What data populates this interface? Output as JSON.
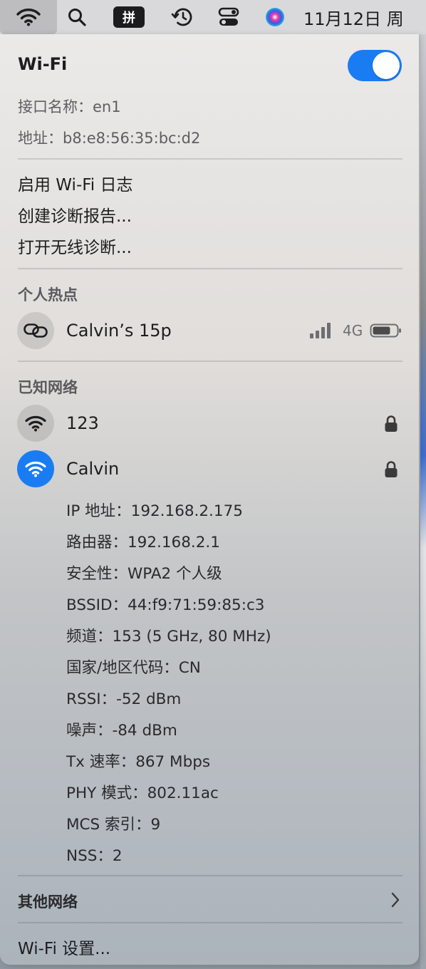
{
  "menubar": {
    "ime_glyph": "拼",
    "date": "11月12日 周"
  },
  "wifi": {
    "title": "Wi-Fi",
    "toggle_on": true,
    "interface_name": "接口名称：en1",
    "address": "地址：b8:e8:56:35:bc:d2"
  },
  "actions": {
    "enable_log": "启用 Wi-Fi 日志",
    "create_report": "创建诊断报告...",
    "open_diagnostics": "打开无线诊断..."
  },
  "hotspot": {
    "section_label": "个人热点",
    "name": "Calvin’s 15p",
    "network_type": "4G",
    "signal_bars": 4
  },
  "known": {
    "section_label": "已知网络",
    "networks": [
      {
        "name": "123",
        "secured": true,
        "connected": false
      },
      {
        "name": "Calvin",
        "secured": true,
        "connected": true
      }
    ],
    "details": [
      "IP 地址：192.168.2.175",
      "路由器：192.168.2.1",
      "安全性：WPA2 个人级",
      "BSSID：44:f9:71:59:85:c3",
      "频道：153 (5 GHz, 80 MHz)",
      "国家/地区代码：CN",
      "RSSI：-52 dBm",
      "噪声：-84 dBm",
      "Tx 速率：867 Mbps",
      "PHY 模式：802.11ac",
      "MCS 索引：9",
      "NSS：2"
    ]
  },
  "footer": {
    "other_networks": "其他网络",
    "settings": "Wi-Fi 设置..."
  },
  "colors": {
    "accent": "#1a7cf2"
  },
  "icons": [
    "wifi-icon",
    "search-icon",
    "time-machine-icon",
    "control-center-icon",
    "siri-icon",
    "hotspot-link-icon",
    "signal-bars-icon",
    "battery-icon",
    "lock-icon",
    "chevron-right-icon"
  ]
}
